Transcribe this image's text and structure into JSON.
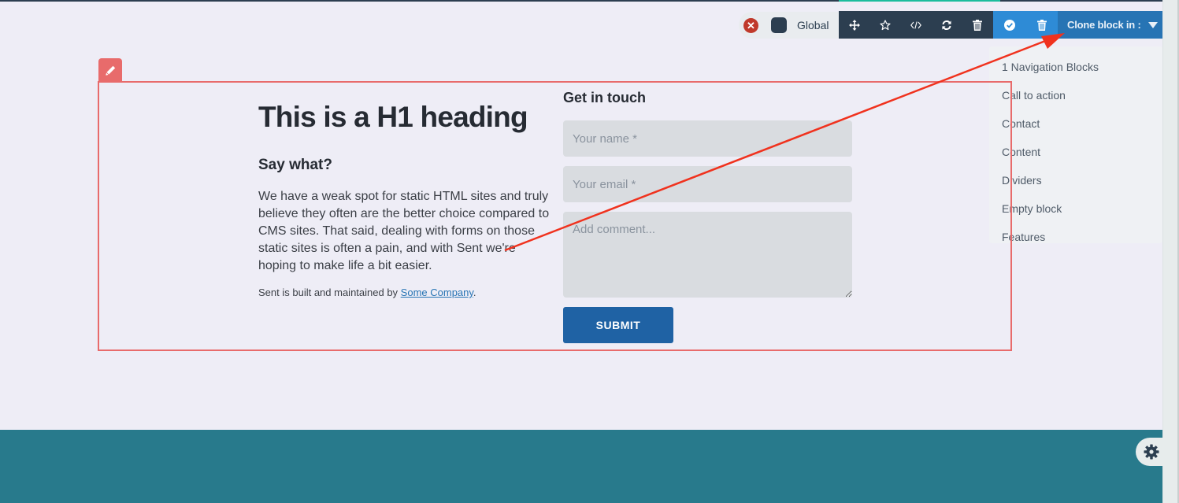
{
  "toolbar": {
    "global_label": "Global",
    "close_icon": "x-circle-icon",
    "swatch_color": "#2c3e50",
    "dark_buttons": [
      {
        "icon": "move-icon",
        "label": "Move"
      },
      {
        "icon": "star-icon",
        "label": "Favorite"
      },
      {
        "icon": "code-icon",
        "label": "Code"
      },
      {
        "icon": "refresh-icon",
        "label": "Reload"
      },
      {
        "icon": "trash-icon",
        "label": "Delete"
      }
    ],
    "blue_buttons": [
      {
        "icon": "check-circle-icon",
        "label": "Confirm"
      },
      {
        "icon": "trash-icon",
        "label": "Delete"
      }
    ],
    "clone_label": "Clone block in :"
  },
  "dropdown": {
    "items": [
      "1 Navigation Blocks",
      "Call to action",
      "Contact",
      "Content",
      "Dividers",
      "Empty block",
      "Features"
    ]
  },
  "block": {
    "edit_icon": "pencil-icon",
    "heading": "This is a H1 heading",
    "subheading": "Say what?",
    "paragraph": "We have a weak spot for static HTML sites and truly believe they often are the better choice compared to CMS sites. That said, dealing with forms on those static sites is often a pain, and with Sent we're hoping to make life a bit easier.",
    "credit_prefix": "Sent is built and maintained by ",
    "credit_link": "Some Company",
    "credit_suffix": "."
  },
  "form": {
    "title": "Get in touch",
    "name_placeholder": "Your name *",
    "email_placeholder": "Your email *",
    "comment_placeholder": "Add comment...",
    "submit_label": "SUBMIT"
  },
  "colors": {
    "accent_red": "#e86b6b",
    "toolbar_dark": "#2c3e50",
    "toolbar_blue": "#2e8bd6",
    "clone_blue": "#2774b4",
    "footer_teal": "#287a8c",
    "submit_blue": "#1f62a4",
    "annotation_arrow": "#f0321e"
  },
  "settings": {
    "icon": "gear-icon"
  }
}
